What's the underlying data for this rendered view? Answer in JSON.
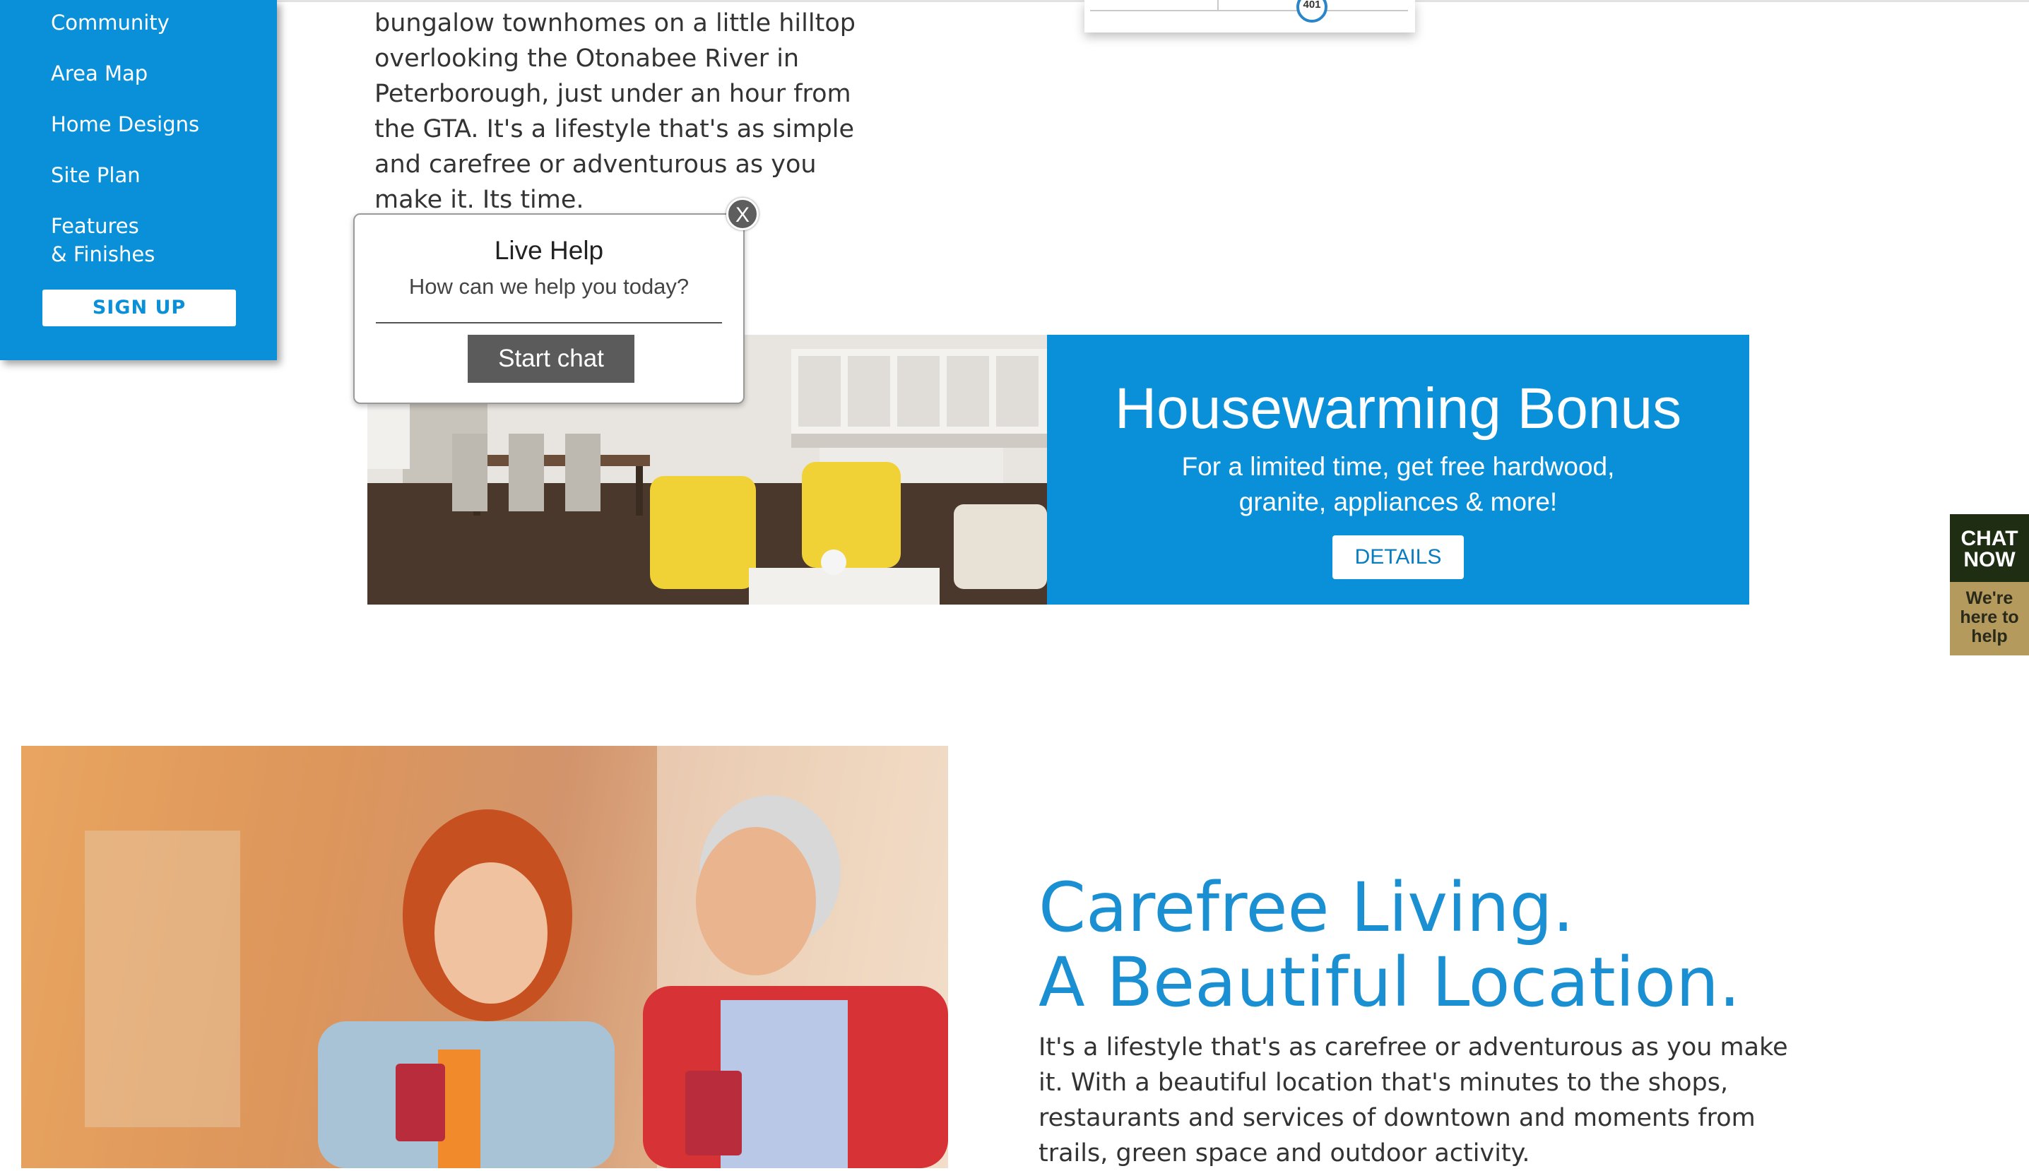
{
  "sidebar": {
    "items": [
      "Community",
      "Area Map",
      "Home Designs",
      "Site Plan"
    ],
    "features_line1": "Features",
    "features_line2": "& Finishes",
    "signup_label": "SIGN UP"
  },
  "intro": {
    "text": "bungalow townhomes on a little hilltop overlooking the Otonabee River in Peterborough, just under an hour from the GTA. It's a lifestyle that's as simple and carefree or adventurous as you make it. Its time."
  },
  "map": {
    "highway_label": "401"
  },
  "live_help": {
    "title": "Live Help",
    "subtitle": "How can we help you today?",
    "start_label": "Start chat",
    "close_label": "X"
  },
  "banner": {
    "title": "Housewarming Bonus",
    "text": "For a limited time, get free hardwood, granite, appliances & more!",
    "details_label": "DETAILS"
  },
  "chat_tab": {
    "line1": "CHAT",
    "line2": "NOW",
    "sub1": "We're",
    "sub2": "here to",
    "sub3": "help"
  },
  "carefree": {
    "title_line1": "Carefree Living.",
    "title_line2": "A Beautiful Location.",
    "text": "It's a lifestyle that's as carefree or adventurous as you make it. With a beautiful location that's minutes to the shops, restaurants and services of downtown and moments from trails, green space and outdoor activity."
  },
  "colors": {
    "brand_blue": "#0a90d8",
    "heading_blue": "#1a8fd2",
    "chat_green": "#1f2e12",
    "chat_gold": "#b59a5e"
  }
}
